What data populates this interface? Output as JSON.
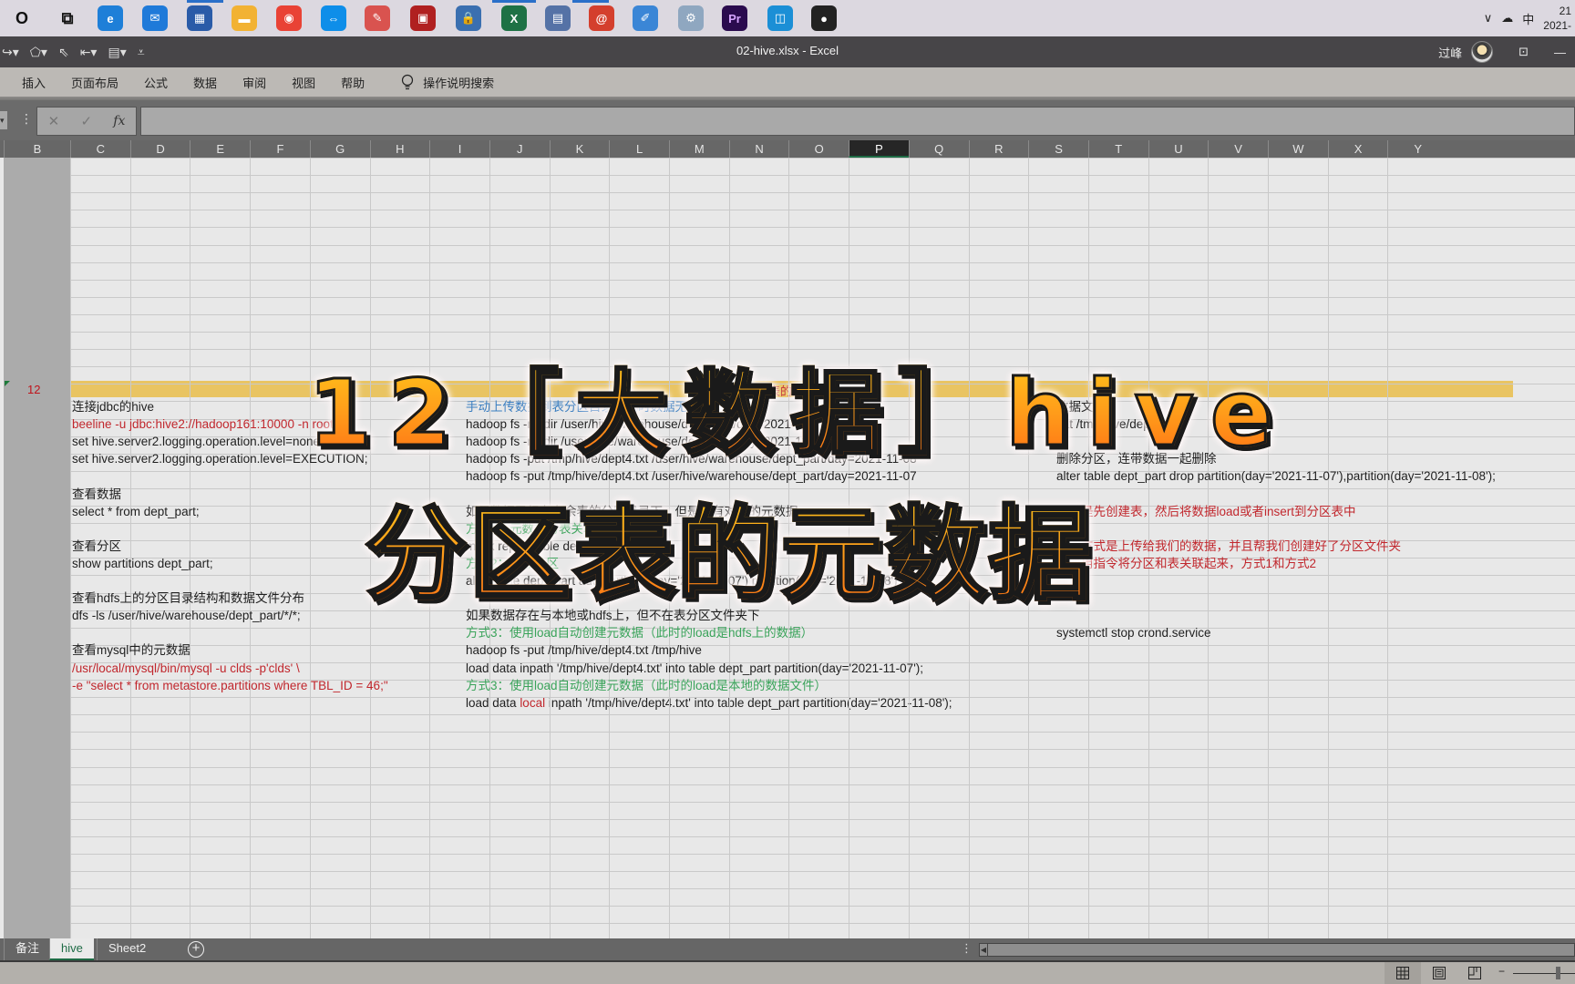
{
  "taskbar": {
    "apps": [
      {
        "name": "cortana",
        "glyph": "O"
      },
      {
        "name": "task-view",
        "glyph": "⧉"
      },
      {
        "name": "edge",
        "glyph": "e"
      },
      {
        "name": "mail",
        "glyph": "✉"
      },
      {
        "name": "store",
        "glyph": "▦"
      },
      {
        "name": "file-explorer",
        "glyph": "▬"
      },
      {
        "name": "chrome",
        "glyph": "◉"
      },
      {
        "name": "teamviewer",
        "glyph": "⇔"
      },
      {
        "name": "app-red-pen",
        "glyph": "✎"
      },
      {
        "name": "app-red-box",
        "glyph": "▣"
      },
      {
        "name": "app-lock",
        "glyph": "🔒"
      },
      {
        "name": "excel",
        "glyph": "X"
      },
      {
        "name": "app-network",
        "glyph": "▤"
      },
      {
        "name": "app-red-swirl",
        "glyph": "@"
      },
      {
        "name": "app-pen-pad",
        "glyph": "✐"
      },
      {
        "name": "app-gears",
        "glyph": "⚙"
      },
      {
        "name": "premiere",
        "glyph": "Pr"
      },
      {
        "name": "app-orange-square",
        "glyph": "◫"
      },
      {
        "name": "obs",
        "glyph": "●"
      }
    ],
    "tray": {
      "chevron": "∨",
      "cloud": "☁",
      "ime": "中",
      "time": "21",
      "date": "2021-"
    }
  },
  "titlebar": {
    "document_title": "02-hive.xlsx  -  Excel",
    "user_name": "过峰",
    "ribbon_display_icon": "⊡",
    "minimize": "—"
  },
  "ribbon": {
    "tabs": [
      "插入",
      "页面布局",
      "公式",
      "数据",
      "审阅",
      "视图",
      "帮助"
    ],
    "search_label": "操作说明搜索"
  },
  "formula_bar": {
    "cancel": "✕",
    "enter": "✓",
    "fx": "fx",
    "value": ""
  },
  "columns": [
    "B",
    "C",
    "D",
    "E",
    "F",
    "G",
    "H",
    "I",
    "J",
    "K",
    "L",
    "M",
    "N",
    "O",
    "P",
    "Q",
    "R",
    "S",
    "T",
    "U",
    "V",
    "W",
    "X",
    "Y"
  ],
  "selected_column": "P",
  "visible_row_number": "12",
  "band_text": "区表的元数",
  "cells": {
    "col_c": [
      {
        "row": 0,
        "text": "连接jdbc的hive",
        "color": "black"
      },
      {
        "row": 1,
        "text": "beeline -u jdbc:hive2://hadoop161:10000 -n root",
        "color": "red"
      },
      {
        "row": 2,
        "text": "set hive.server2.logging.operation.level=none;",
        "color": "black"
      },
      {
        "row": 3,
        "text": "set hive.server2.logging.operation.level=EXECUTION;",
        "color": "black"
      },
      {
        "row": 5,
        "text": "查看数据",
        "color": "black"
      },
      {
        "row": 6,
        "text": "select * from dept_part;",
        "color": "black"
      },
      {
        "row": 8,
        "text": "查看分区",
        "color": "black"
      },
      {
        "row": 9,
        "text": "show partitions dept_part;",
        "color": "black"
      },
      {
        "row": 11,
        "text": "查看hdfs上的分区目录结构和数据文件分布",
        "color": "black"
      },
      {
        "row": 12,
        "text": "dfs -ls /user/hive/warehouse/dept_part/*/*;",
        "color": "black"
      },
      {
        "row": 14,
        "text": "查看mysql中的元数据",
        "color": "black"
      },
      {
        "row": 15,
        "text": "/usr/local/mysql/bin/mysql -u clds -p'clds' \\",
        "color": "red"
      },
      {
        "row": 16,
        "text": "-e \"select * from metastore.partitions where TBL_ID = 46;\"",
        "color": "red"
      }
    ],
    "col_i": [
      {
        "row": 0,
        "text": "手动上传数据到表分区目录，此时数据无法被查询到",
        "color": "blue"
      },
      {
        "row": 1,
        "text": "hadoop fs -mkdir /user/hive/warehouse/dept_part/day=2021-11-08",
        "color": "black"
      },
      {
        "row": 2,
        "text": "hadoop fs -mkdir /user/hive/warehouse/dept_part/day=2021-11-07",
        "color": "black"
      },
      {
        "row": 3,
        "text": "hadoop fs -put /tmp/hive/dept4.txt /user/hive/warehouse/dept_part/day=2021-11-08",
        "color": "black"
      },
      {
        "row": 4,
        "text": "hadoop fs -put /tmp/hive/dept4.txt /user/hive/warehouse/dept_part/day=2021-11-07",
        "color": "black"
      },
      {
        "row": 6,
        "text": "如果数据已经存在余表的分区目录下，但是没有对应的元数据",
        "color": "black"
      },
      {
        "row": 7,
        "text": "方式1：元数据与表关联",
        "color": "green"
      },
      {
        "row": 8,
        "text": "msck repair table dept_part;",
        "color": "black"
      },
      {
        "row": 9,
        "text": "方式2：添加分区",
        "color": "green"
      },
      {
        "row": 10,
        "text": "alter table dept_part add partition(day='2021-11-07') partition(day='2021-11-08');",
        "color": "black"
      },
      {
        "row": 12,
        "text": "如果数据存在与本地或hdfs上，但不在表分区文件夹下",
        "color": "black"
      },
      {
        "row": 13,
        "text": "方式3：使用load自动创建元数据（此时的load是hdfs上的数据）",
        "color": "green"
      },
      {
        "row": 14,
        "text": "hadoop fs -put /tmp/hive/dept4.txt /tmp/hive",
        "color": "black"
      },
      {
        "row": 15,
        "text": "load data inpath '/tmp/hive/dept4.txt' into table dept_part partition(day='2021-11-07');",
        "color": "black"
      },
      {
        "row": 16,
        "text": "方式3：使用load自动创建元数据（此时的load是本地的数据文件）",
        "color": "green"
      }
    ],
    "col_i_row17": {
      "before": "load data ",
      "highlight": "local",
      "after": " inpath '/tmp/hive/dept4.txt' into table dept_part partition(day='2021-11-08');"
    },
    "col_r": [
      {
        "row": 0,
        "text": "数据文件",
        "color": "black"
      },
      {
        "row": 1,
        "text": "cat /tmp/hive/dept4.txt",
        "color": "black"
      },
      {
        "row": 3,
        "text": "删除分区，连带数据一起删除",
        "color": "black"
      },
      {
        "row": 4,
        "text": "alter table dept_part drop partition(day='2021-11-07'),partition(day='2021-11-08');",
        "color": "black"
      },
      {
        "row": 6,
        "text": "正常是先创建表，然后将数据load或者insert到分区表中",
        "color": "red"
      },
      {
        "row": 8,
        "text": "上面方式是上传给我们的数据，并且帮我们创建好了分区文件夹",
        "color": "red"
      },
      {
        "row": 9,
        "text": "需要用指令将分区和表关联起来，方式1和方式2",
        "color": "red"
      },
      {
        "row": 13,
        "text": "systemctl stop crond.service",
        "color": "black"
      }
    ]
  },
  "overlay": {
    "line1": "12［大数据］hive",
    "line2": "分区表的元数据"
  },
  "sheet_tabs": [
    {
      "label": "备注",
      "active": false
    },
    {
      "label": "hive",
      "active": true
    },
    {
      "label": "Sheet2",
      "active": false
    }
  ],
  "add_sheet": "+",
  "status_bar": {
    "views": [
      {
        "name": "normal-view",
        "glyph": "▦",
        "active": true
      },
      {
        "name": "page-layout-view",
        "glyph": "▤",
        "active": false
      },
      {
        "name": "page-break-view",
        "glyph": "◫",
        "active": false
      }
    ],
    "zoom_minus": "−"
  },
  "colors": {
    "red_text": "#c1272d",
    "blue_text": "#3c7fc1",
    "green_text": "#3aa35a",
    "band": "#e9c462",
    "excel_green": "#1e6b45"
  }
}
